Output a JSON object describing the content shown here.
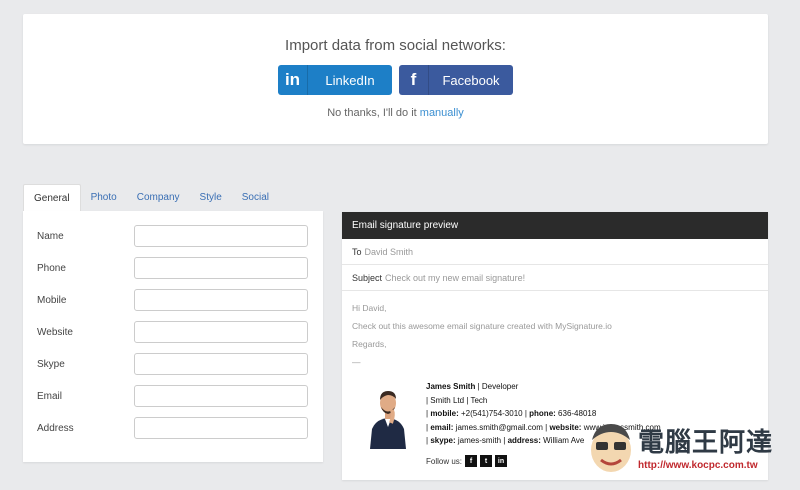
{
  "import": {
    "title": "Import data from social networks:",
    "linkedin_icon": "in",
    "linkedin_label": "LinkedIn",
    "facebook_icon": "f",
    "facebook_label": "Facebook",
    "no_thanks_prefix": "No thanks, I'll do it",
    "manually_link": "manually"
  },
  "tabs": [
    "General",
    "Photo",
    "Company",
    "Style",
    "Social"
  ],
  "form": {
    "fields": [
      "Name",
      "Phone",
      "Mobile",
      "Website",
      "Skype",
      "Email",
      "Address"
    ]
  },
  "preview": {
    "header": "Email signature preview",
    "to_label": "To",
    "to_value": "David Smith",
    "subject_label": "Subject",
    "subject_value": "Check out my new email signature!",
    "body": [
      "Hi David,",
      "Check out this awesome email signature created with MySignature.io",
      "Regards,",
      "—"
    ],
    "signature": {
      "name": "James Smith",
      "title_sep": " | Developer",
      "line2": "| Smith Ltd | Tech",
      "mobile_label": "mobile:",
      "mobile_value": "+2(541)754-3010",
      "phone_label": "phone:",
      "phone_value": "636-48018",
      "email_label": "email:",
      "email_value": "james.smith@gmail.com",
      "website_label": "website:",
      "website_value": "www.jamessmith.com",
      "skype_label": "skype:",
      "skype_value": "james-smith",
      "address_label": "address:",
      "address_value": "William Ave",
      "follow_label": "Follow us:",
      "icons": [
        "f",
        "t",
        "in"
      ]
    }
  },
  "watermark": {
    "title": "電腦王阿達",
    "url": "http://www.kocpc.com.tw"
  },
  "colors": {
    "linkedin": "#1d7fc7",
    "facebook": "#3b5a9e",
    "link": "#3b8fd1",
    "preview_header": "#2b2b2b"
  }
}
